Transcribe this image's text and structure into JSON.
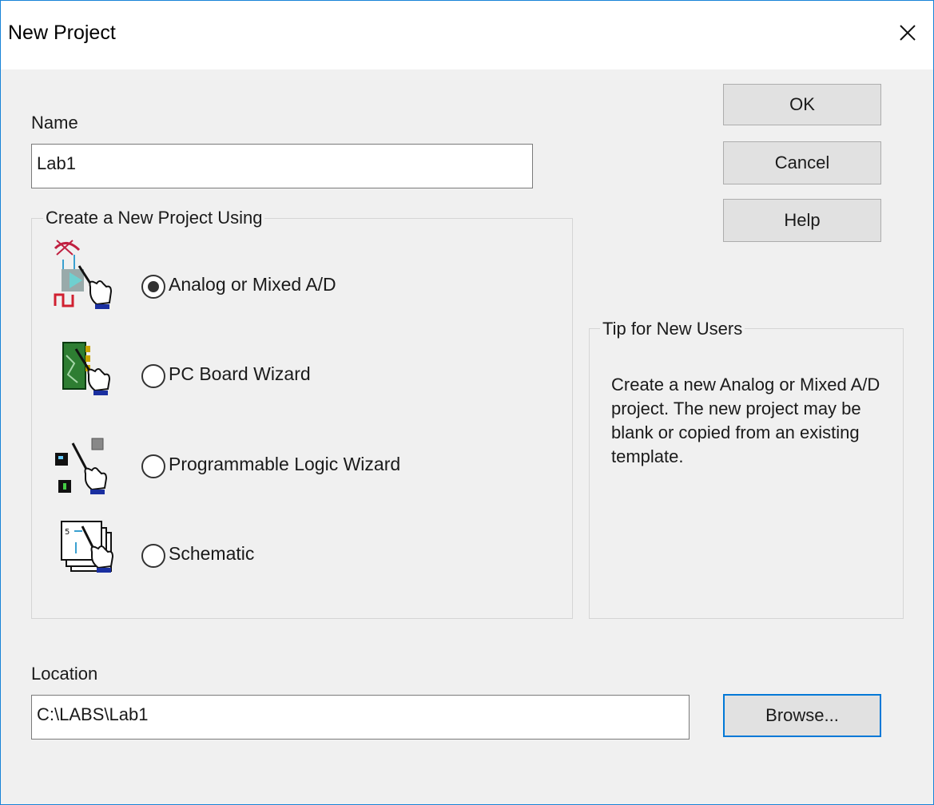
{
  "window": {
    "title": "New Project"
  },
  "name": {
    "label": "Name",
    "value": "Lab1"
  },
  "buttons": {
    "ok": "OK",
    "cancel": "Cancel",
    "help": "Help",
    "browse": "Browse..."
  },
  "project_type": {
    "legend": "Create a New Project Using",
    "selected": "Analog or Mixed A/D",
    "options": [
      {
        "label": "Analog or Mixed A/D",
        "icon": "analog-project-icon",
        "checked": true
      },
      {
        "label": "PC Board Wizard",
        "icon": "pcb-wizard-icon",
        "checked": false
      },
      {
        "label": "Programmable Logic Wizard",
        "icon": "programmable-logic-icon",
        "checked": false
      },
      {
        "label": "Schematic",
        "icon": "schematic-icon",
        "checked": false
      }
    ]
  },
  "tip": {
    "legend": "Tip for New Users",
    "text": "Create a new Analog or Mixed A/D project.  The new project may be blank or copied from an existing template."
  },
  "location": {
    "label": "Location",
    "value": "C:\\LABS\\Lab1"
  },
  "colors": {
    "accent": "#0078d7",
    "window_border": "#1883d7",
    "background": "#f0f0f0"
  }
}
